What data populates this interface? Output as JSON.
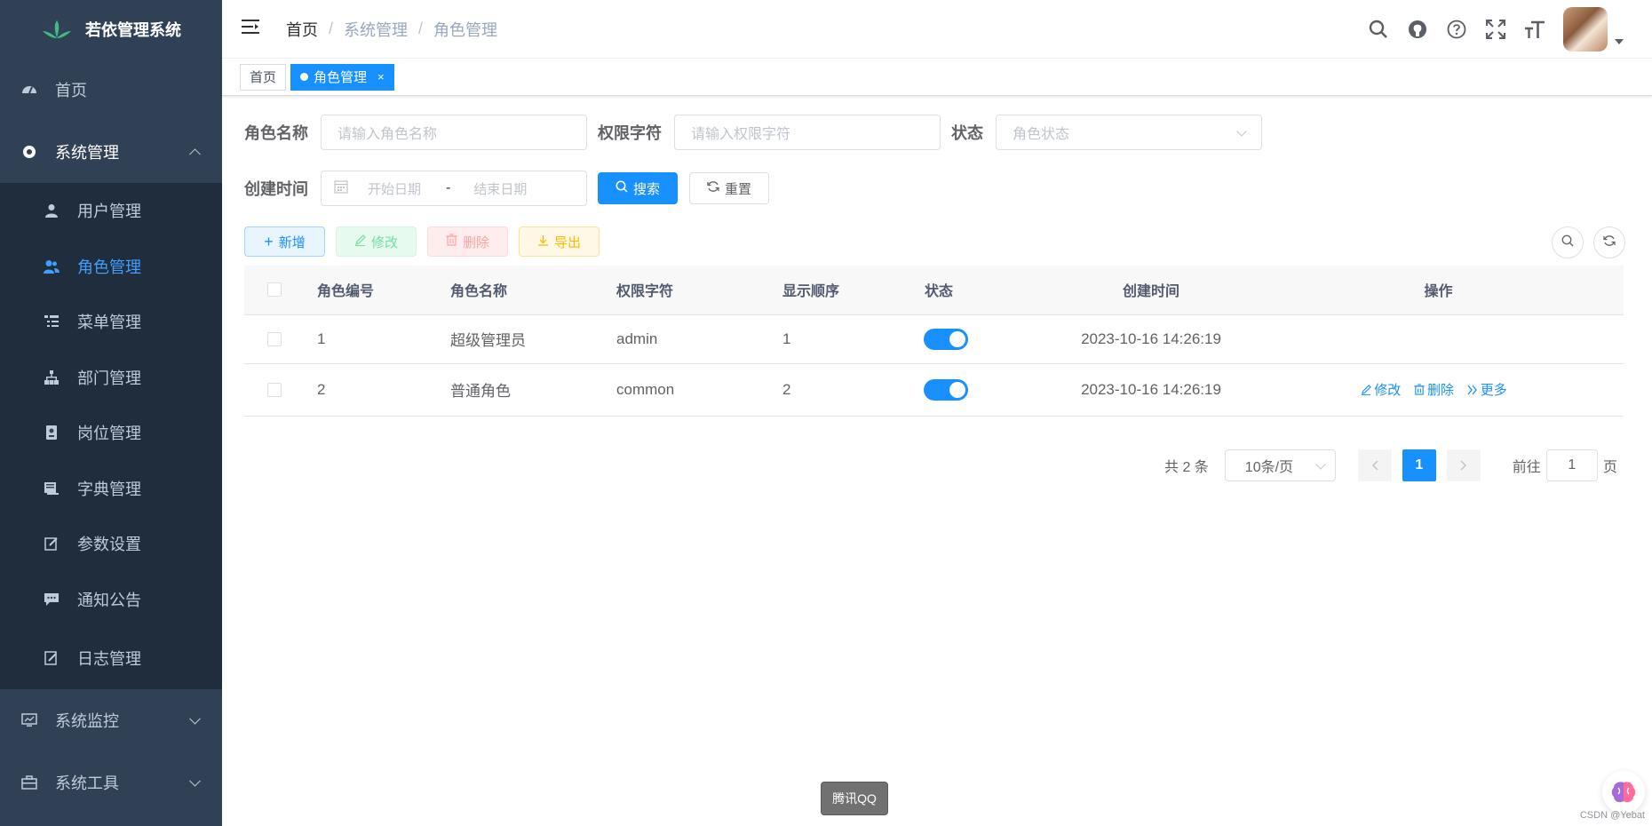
{
  "app": {
    "logo_text": "若依管理系统"
  },
  "sidebar": {
    "items": [
      {
        "label": "首页"
      },
      {
        "label": "系统管理"
      },
      {
        "label": "系统监控"
      },
      {
        "label": "系统工具"
      }
    ],
    "sub_items": [
      {
        "label": "用户管理"
      },
      {
        "label": "角色管理"
      },
      {
        "label": "菜单管理"
      },
      {
        "label": "部门管理"
      },
      {
        "label": "岗位管理"
      },
      {
        "label": "字典管理"
      },
      {
        "label": "参数设置"
      },
      {
        "label": "通知公告"
      },
      {
        "label": "日志管理"
      }
    ]
  },
  "breadcrumb": [
    "首页",
    "系统管理",
    "角色管理"
  ],
  "tags": {
    "home": "首页",
    "active": "角色管理",
    "close": "×"
  },
  "search_form": {
    "role_name_label": "角色名称",
    "role_name_placeholder": "请输入角色名称",
    "role_key_label": "权限字符",
    "role_key_placeholder": "请输入权限字符",
    "status_label": "状态",
    "status_placeholder": "角色状态",
    "create_time_label": "创建时间",
    "start_placeholder": "开始日期",
    "range_sep": "-",
    "end_placeholder": "结束日期",
    "search_btn": "搜索",
    "reset_btn": "重置"
  },
  "toolbar": {
    "add": "新增",
    "edit": "修改",
    "delete": "删除",
    "export": "导出"
  },
  "table": {
    "columns": [
      "角色编号",
      "角色名称",
      "权限字符",
      "显示顺序",
      "状态",
      "创建时间",
      "操作"
    ],
    "rows": [
      {
        "id": "1",
        "name": "超级管理员",
        "key": "admin",
        "sort": "1",
        "status": true,
        "time": "2023-10-16 14:26:19"
      },
      {
        "id": "2",
        "name": "普通角色",
        "key": "common",
        "sort": "2",
        "status": true,
        "time": "2023-10-16 14:26:19",
        "ops": [
          "修改",
          "删除",
          "更多"
        ]
      }
    ]
  },
  "pagination": {
    "total": "共 2 条",
    "page_size": "10条/页",
    "current": "1",
    "goto_label": "前往",
    "goto_value": "1",
    "page_suffix": "页"
  },
  "tooltip": "腾讯QQ",
  "watermark": "CSDN @Yebat"
}
